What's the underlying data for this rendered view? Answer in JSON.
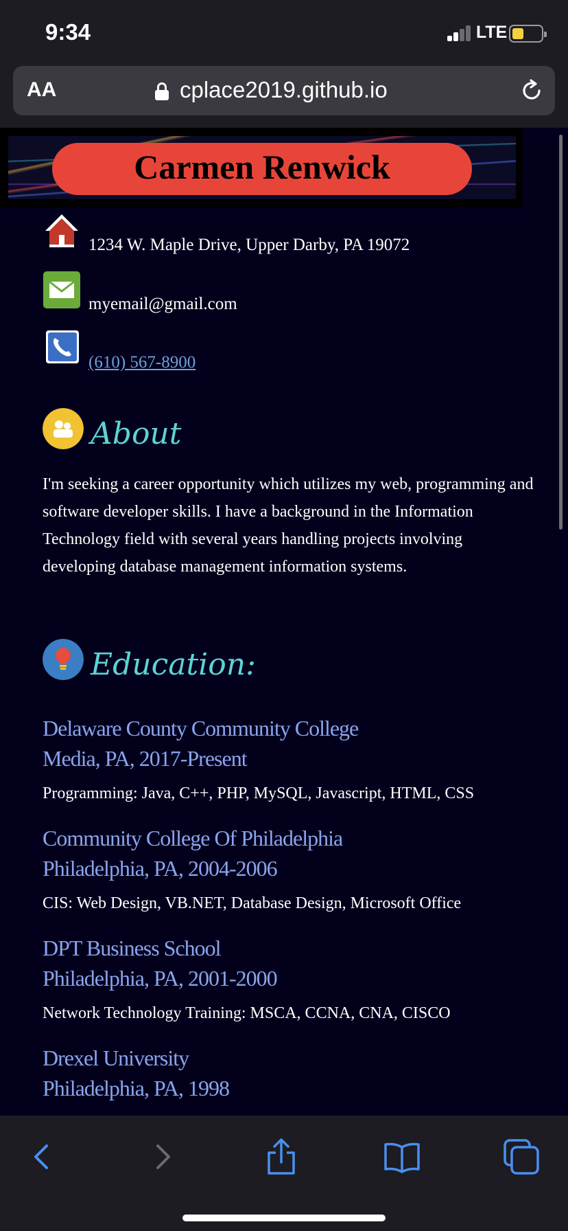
{
  "status": {
    "time": "9:34",
    "network": "LTE"
  },
  "browser": {
    "text_size_label": "AA",
    "url": "cplace2019.github.io"
  },
  "header": {
    "name": "Carmen Renwick"
  },
  "contact": {
    "address": "1234 W. Maple Drive, Upper Darby, PA 19072",
    "email": "myemail@gmail.com",
    "phone": "(610) 567-8900"
  },
  "about": {
    "title": "About",
    "text": "I'm seeking a career opportunity which utilizes my web, programming and software developer skills. I have a background in the Information Technology field with several years handling projects involving developing database management information systems."
  },
  "education": {
    "title": "Education:",
    "items": [
      {
        "school": "Delaware County Community College",
        "location": "Media, PA, 2017-Present",
        "desc": "Programming: Java, C++, PHP, MySQL, Javascript, HTML, CSS"
      },
      {
        "school": "Community College Of Philadelphia",
        "location": "Philadelphia, PA, 2004-2006",
        "desc": "CIS: Web Design, VB.NET, Database Design, Microsoft Office"
      },
      {
        "school": "DPT Business School",
        "location": "Philadelphia, PA, 2001-2000",
        "desc": "Network Technology Training: MSCA, CCNA, CNA, CISCO"
      },
      {
        "school": "Drexel University",
        "location": "Philadelphia, PA, 1998"
      }
    ]
  },
  "toolbar": {
    "icons": [
      "back-icon",
      "forward-icon",
      "share-icon",
      "bookmarks-icon",
      "tabs-icon"
    ]
  },
  "colors": {
    "accent_link": "#8aa4ec",
    "section_title": "#5ed3d4",
    "name_pill": "#e8453a",
    "page_bg": "#03001c"
  }
}
